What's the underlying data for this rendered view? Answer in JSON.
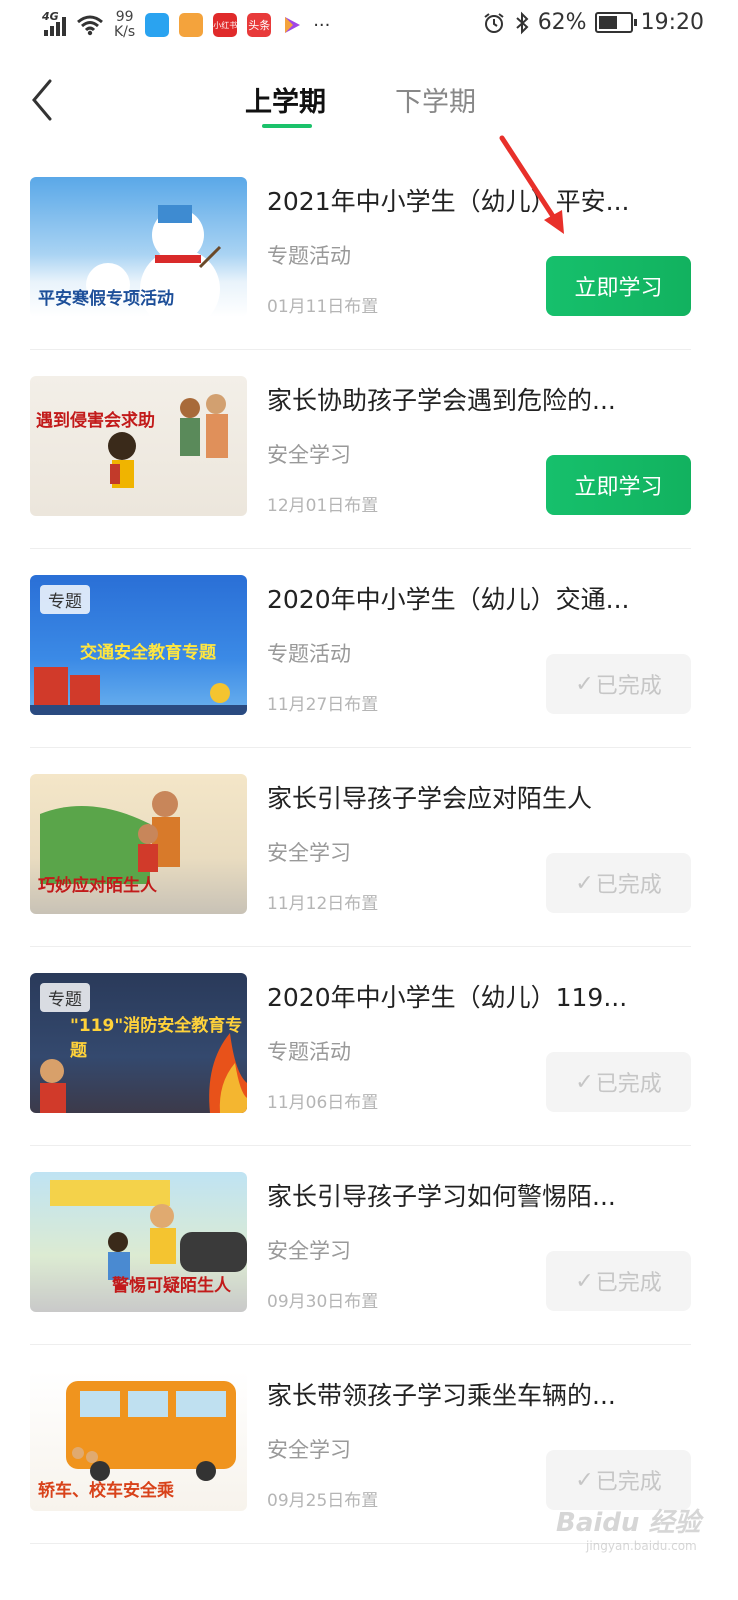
{
  "status_bar": {
    "network": "4G",
    "speed_value": "99",
    "speed_unit": "K/s",
    "more": "···",
    "battery": "62%",
    "time": "19:20",
    "app_icon_colors": [
      "#2aa3f0",
      "#f4a33c",
      "#e02a2a",
      "#e83a3a",
      "#a046e6"
    ],
    "app_labels": [
      "小红书",
      "头条"
    ]
  },
  "header": {
    "tabs": [
      {
        "label": "上学期",
        "active": true
      },
      {
        "label": "下学期",
        "active": false
      }
    ]
  },
  "colors": {
    "accent": "#1bc26b",
    "done_text": "#c6c6c6"
  },
  "items": [
    {
      "title": "2021年中小学生（幼儿）平安...",
      "category": "专题活动",
      "date": "01月11日布置",
      "button": "立即学习",
      "status": "todo",
      "thumb_caption": "平安寒假专项活动",
      "thumb_tag": ""
    },
    {
      "title": "家长协助孩子学会遇到危险的...",
      "category": "安全学习",
      "date": "12月01日布置",
      "button": "立即学习",
      "status": "todo",
      "thumb_caption": "遇到侵害会求助",
      "thumb_tag": ""
    },
    {
      "title": "2020年中小学生（幼儿）交通...",
      "category": "专题活动",
      "date": "11月27日布置",
      "button": "已完成",
      "status": "done",
      "thumb_caption": "交通安全教育专题",
      "thumb_tag": "专题"
    },
    {
      "title": "家长引导孩子学会应对陌生人",
      "category": "安全学习",
      "date": "11月12日布置",
      "button": "已完成",
      "status": "done",
      "thumb_caption": "巧妙应对陌生人",
      "thumb_tag": ""
    },
    {
      "title": "2020年中小学生（幼儿）119...",
      "category": "专题活动",
      "date": "11月06日布置",
      "button": "已完成",
      "status": "done",
      "thumb_caption": "\"119\"消防安全教育专题",
      "thumb_tag": "专题"
    },
    {
      "title": "家长引导孩子学习如何警惕陌...",
      "category": "安全学习",
      "date": "09月30日布置",
      "button": "已完成",
      "status": "done",
      "thumb_caption": "警惕可疑陌生人",
      "thumb_tag": ""
    },
    {
      "title": "家长带领孩子学习乘坐车辆的...",
      "category": "安全学习",
      "date": "09月25日布置",
      "button": "已完成",
      "status": "done",
      "thumb_caption": "轿车、校车安全乘",
      "thumb_tag": ""
    }
  ],
  "watermark": {
    "brand": "Baidu 经验",
    "url": "jingyan.baidu.com"
  }
}
